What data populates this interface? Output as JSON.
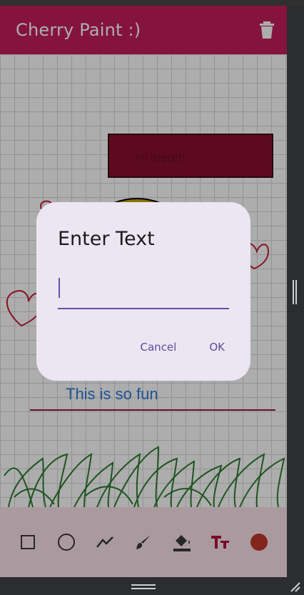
{
  "app": {
    "title": "Cherry Paint :)",
    "accent_color": "#c41e5a",
    "delete_icon": "trash-icon"
  },
  "canvas": {
    "texts": {
      "greeting": "Hi there!!",
      "caption": "This is so fun"
    },
    "colors": {
      "rectangle_fill": "#8a0f2e",
      "smiley_fill": "#c9a800",
      "hearts": "#c41e3a",
      "grass": "#2e7d32",
      "underline": "#a0103a",
      "caption_text": "#2c7bd8"
    }
  },
  "toolbar": {
    "tools": [
      {
        "name": "rectangle",
        "icon": "square-outline-icon"
      },
      {
        "name": "circle",
        "icon": "circle-outline-icon"
      },
      {
        "name": "line",
        "icon": "polyline-icon"
      },
      {
        "name": "brush",
        "icon": "brush-icon"
      },
      {
        "name": "fill",
        "icon": "paint-bucket-icon"
      },
      {
        "name": "text",
        "icon": "text-tool-icon"
      },
      {
        "name": "color",
        "icon": "color-dot-icon"
      }
    ],
    "selected_color": "#c0392b",
    "active_tool": "text"
  },
  "dialog": {
    "title": "Enter Text",
    "input_value": "",
    "cancel_label": "Cancel",
    "ok_label": "OK"
  }
}
